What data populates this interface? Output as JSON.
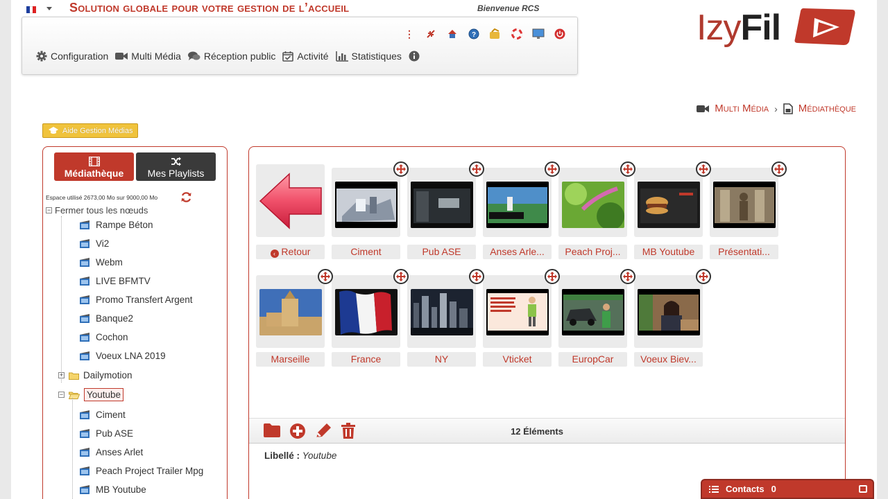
{
  "header": {
    "tagline": "Solution globale pour votre gestion de l’accueil",
    "welcome": "Bienvenue RCS",
    "logo": {
      "part1": "Izy",
      "part2": "Fil"
    },
    "language_flag": "fr-flag"
  },
  "menu": [
    {
      "label": "Configuration",
      "icon": "gear-icon"
    },
    {
      "label": "Multi Média",
      "icon": "video-camera-icon"
    },
    {
      "label": "Réception public",
      "icon": "chat-bubbles-icon"
    },
    {
      "label": "Activité",
      "icon": "calendar-check-icon"
    },
    {
      "label": "Statistiques",
      "icon": "bar-chart-icon"
    }
  ],
  "breadcrumb": {
    "level1": "Multi Média",
    "level2": "Médiathèque"
  },
  "help_button": "Aide Gestion Médias",
  "left_panel": {
    "tab_library": "Médiathèque",
    "tab_playlists": "Mes Playlists",
    "space_used": "Espace utilisé 2673,00 Mo sur 9000,00 Mo",
    "collapse_all": "Fermer tous les nœuds",
    "root_items": [
      "Rampe Béton",
      "Vi2",
      "Webm",
      "LIVE BFMTV",
      "Promo Transfert Argent",
      "Banque2",
      "Cochon",
      "Voeux LNA 2019"
    ],
    "folder_dailymotion": "Dailymotion",
    "folder_youtube": "Youtube",
    "youtube_items": [
      "Ciment",
      "Pub ASE",
      "Anses Arlet",
      "Peach Project Trailer Mpg",
      "MB Youtube"
    ]
  },
  "grid": {
    "back_label": "Retour",
    "row1": [
      "Ciment",
      "Pub ASE",
      "Anses Arle...",
      "Peach Proj...",
      "MB Youtube",
      "Présentati..."
    ],
    "row2": [
      "Marseille",
      "France",
      "NY",
      "Vticket",
      "EuropCar",
      "Voeux Biev..."
    ],
    "count": "12 Éléments",
    "libelle_label": "Libellé :",
    "libelle_value": "Youtube"
  },
  "contacts": {
    "label": "Contacts",
    "count": "0"
  },
  "colors": {
    "accent": "#c0392b",
    "dark_tab": "#3a3a3a",
    "help_yellow": "#f0c33c"
  }
}
